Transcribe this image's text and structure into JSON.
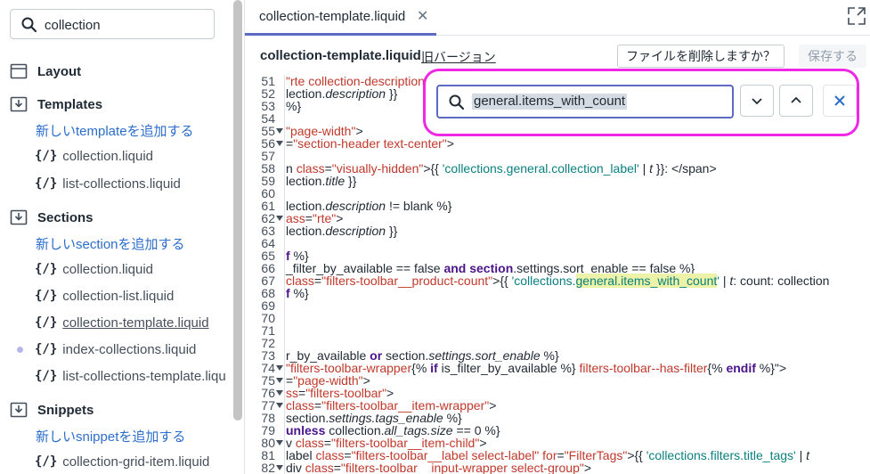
{
  "sidebar": {
    "search_value": "collection",
    "sections": [
      {
        "title": "Layout"
      },
      {
        "title": "Templates"
      },
      {
        "title": "Sections"
      },
      {
        "title": "Snippets"
      }
    ],
    "templates": {
      "add_label": "新しいtemplateを追加する",
      "files": [
        "collection.liquid",
        "list-collections.liquid"
      ]
    },
    "sections_group": {
      "add_label": "新しいsectionを追加する",
      "files": [
        "collection.liquid",
        "collection-list.liquid",
        "collection-template.liquid",
        "index-collections.liquid",
        "list-collections-template.liqu"
      ]
    },
    "snippets": {
      "add_label": "新しいsnippetを追加する",
      "files": [
        "collection-grid-item.liquid"
      ]
    },
    "file_icon": "{/}"
  },
  "tabbar": {
    "tab_label": "collection-template.liquid",
    "close_glyph": "✕"
  },
  "filebar": {
    "filename": "collection-template.liquid",
    "old_version_link": "旧バージョン",
    "delete_button": "ファイルを削除しますか？",
    "save_button": "保存する"
  },
  "find": {
    "query": "general.items_with_count"
  },
  "code": {
    "lines": [
      {
        "n": "51",
        "fold": false,
        "html": "<span class=\"c-str\">\"rte collection-description\"</span>"
      },
      {
        "n": "52",
        "fold": false,
        "html": "lection.<span class=\"c-it\">description</span> }}"
      },
      {
        "n": "53",
        "fold": false,
        "html": "%}"
      },
      {
        "n": "54",
        "fold": false,
        "html": ""
      },
      {
        "n": "55",
        "fold": true,
        "html": "<span class=\"c-str\">\"page-width\"</span>&gt;"
      },
      {
        "n": "56",
        "fold": true,
        "html": "=<span class=\"c-str\">\"section-header text-center\"</span>&gt;"
      },
      {
        "n": "57",
        "fold": false,
        "html": ""
      },
      {
        "n": "58",
        "fold": false,
        "html": "n <span class=\"c-str\">class</span>=<span class=\"c-str\">\"visually-hidden\"</span>&gt;{{ <span class=\"c-lq\">'collections.general.collection_label'</span> | <span class=\"c-it\">t</span> }}: &lt;/span&gt;"
      },
      {
        "n": "59",
        "fold": false,
        "html": "lection.<span class=\"c-it\">title</span> }}"
      },
      {
        "n": "60",
        "fold": false,
        "html": ""
      },
      {
        "n": "61",
        "fold": false,
        "html": "lection.<span class=\"c-it\">description</span> != blank %}"
      },
      {
        "n": "62",
        "fold": true,
        "html": "<span class=\"c-str\">ass</span>=<span class=\"c-str\">\"rte\"</span>&gt;"
      },
      {
        "n": "63",
        "fold": false,
        "html": "lection.<span class=\"c-it\">description</span> }}"
      },
      {
        "n": "64",
        "fold": false,
        "html": ""
      },
      {
        "n": "65",
        "fold": false,
        "html": "<span class=\"c-kw\">f</span> %}"
      },
      {
        "n": "66",
        "fold": false,
        "html": "_filter_by_available == false <span class=\"c-kw\">and</span> <span class=\"c-kw\">section</span>.settings.sort_enable == false %}"
      },
      {
        "n": "67",
        "fold": false,
        "html": "<span class=\"c-str\">class</span>=<span class=\"c-str\">\"filters-toolbar__product-count\"</span>&gt;{{ <span class=\"c-lq\">'collections.<span class=\"c-hl\">general.items_with_count</span>'</span> | <span class=\"c-it\">t</span>: count: collection"
      },
      {
        "n": "68",
        "fold": false,
        "html": "<span class=\"c-kw\">f</span> %}"
      },
      {
        "n": "69",
        "fold": false,
        "html": ""
      },
      {
        "n": "70",
        "fold": false,
        "html": ""
      },
      {
        "n": "71",
        "fold": false,
        "html": ""
      },
      {
        "n": "72",
        "fold": false,
        "html": ""
      },
      {
        "n": "73",
        "fold": false,
        "html": "r_by_available <span class=\"c-kw\">or</span> section.<span class=\"c-it\">settings.sort_enable</span> %}"
      },
      {
        "n": "74",
        "fold": true,
        "html": "<span class=\"c-str\">\"filters-toolbar-wrapper</span>{% <span class=\"c-kw\">if</span> is_filter_by_available %} <span class=\"c-str\">filters-toolbar--has-filter</span>{% <span class=\"c-kw\">endif</span> %}\"&gt;"
      },
      {
        "n": "75",
        "fold": true,
        "html": "=<span class=\"c-str\">\"page-width\"</span>&gt;"
      },
      {
        "n": "76",
        "fold": true,
        "html": "<span class=\"c-str\">ss</span>=<span class=\"c-str\">\"filters-toolbar\"</span>&gt;"
      },
      {
        "n": "77",
        "fold": true,
        "html": "<span class=\"c-str\">class</span>=<span class=\"c-str\">\"filters-toolbar__item-wrapper\"</span>&gt;"
      },
      {
        "n": "78",
        "fold": false,
        "html": "section.<span class=\"c-it\">settings.tags_enable</span> %}"
      },
      {
        "n": "79",
        "fold": false,
        "html": "<span class=\"c-kw\">unless</span> collection.<span class=\"c-it\">all_tags.size</span> == 0 %}"
      },
      {
        "n": "80",
        "fold": true,
        "html": "v <span class=\"c-str\">class</span>=<span class=\"c-str\">\"filters-toolbar__item-child\"</span>&gt;"
      },
      {
        "n": "81",
        "fold": false,
        "html": "label <span class=\"c-str\">class</span>=<span class=\"c-str\">\"filters-toolbar__label select-label\"</span> <span class=\"c-str\">for</span>=<span class=\"c-str\">\"FilterTags\"</span>&gt;{{ <span class=\"c-lq\">'collections.filters.title_tags'</span> | <span class=\"c-it\">t</span>"
      },
      {
        "n": "82",
        "fold": true,
        "html": "div <span class=\"c-str\">class</span>=<span class=\"c-str\">\"filters-toolbar__input-wrapper select-group\"</span>&gt;"
      }
    ]
  }
}
